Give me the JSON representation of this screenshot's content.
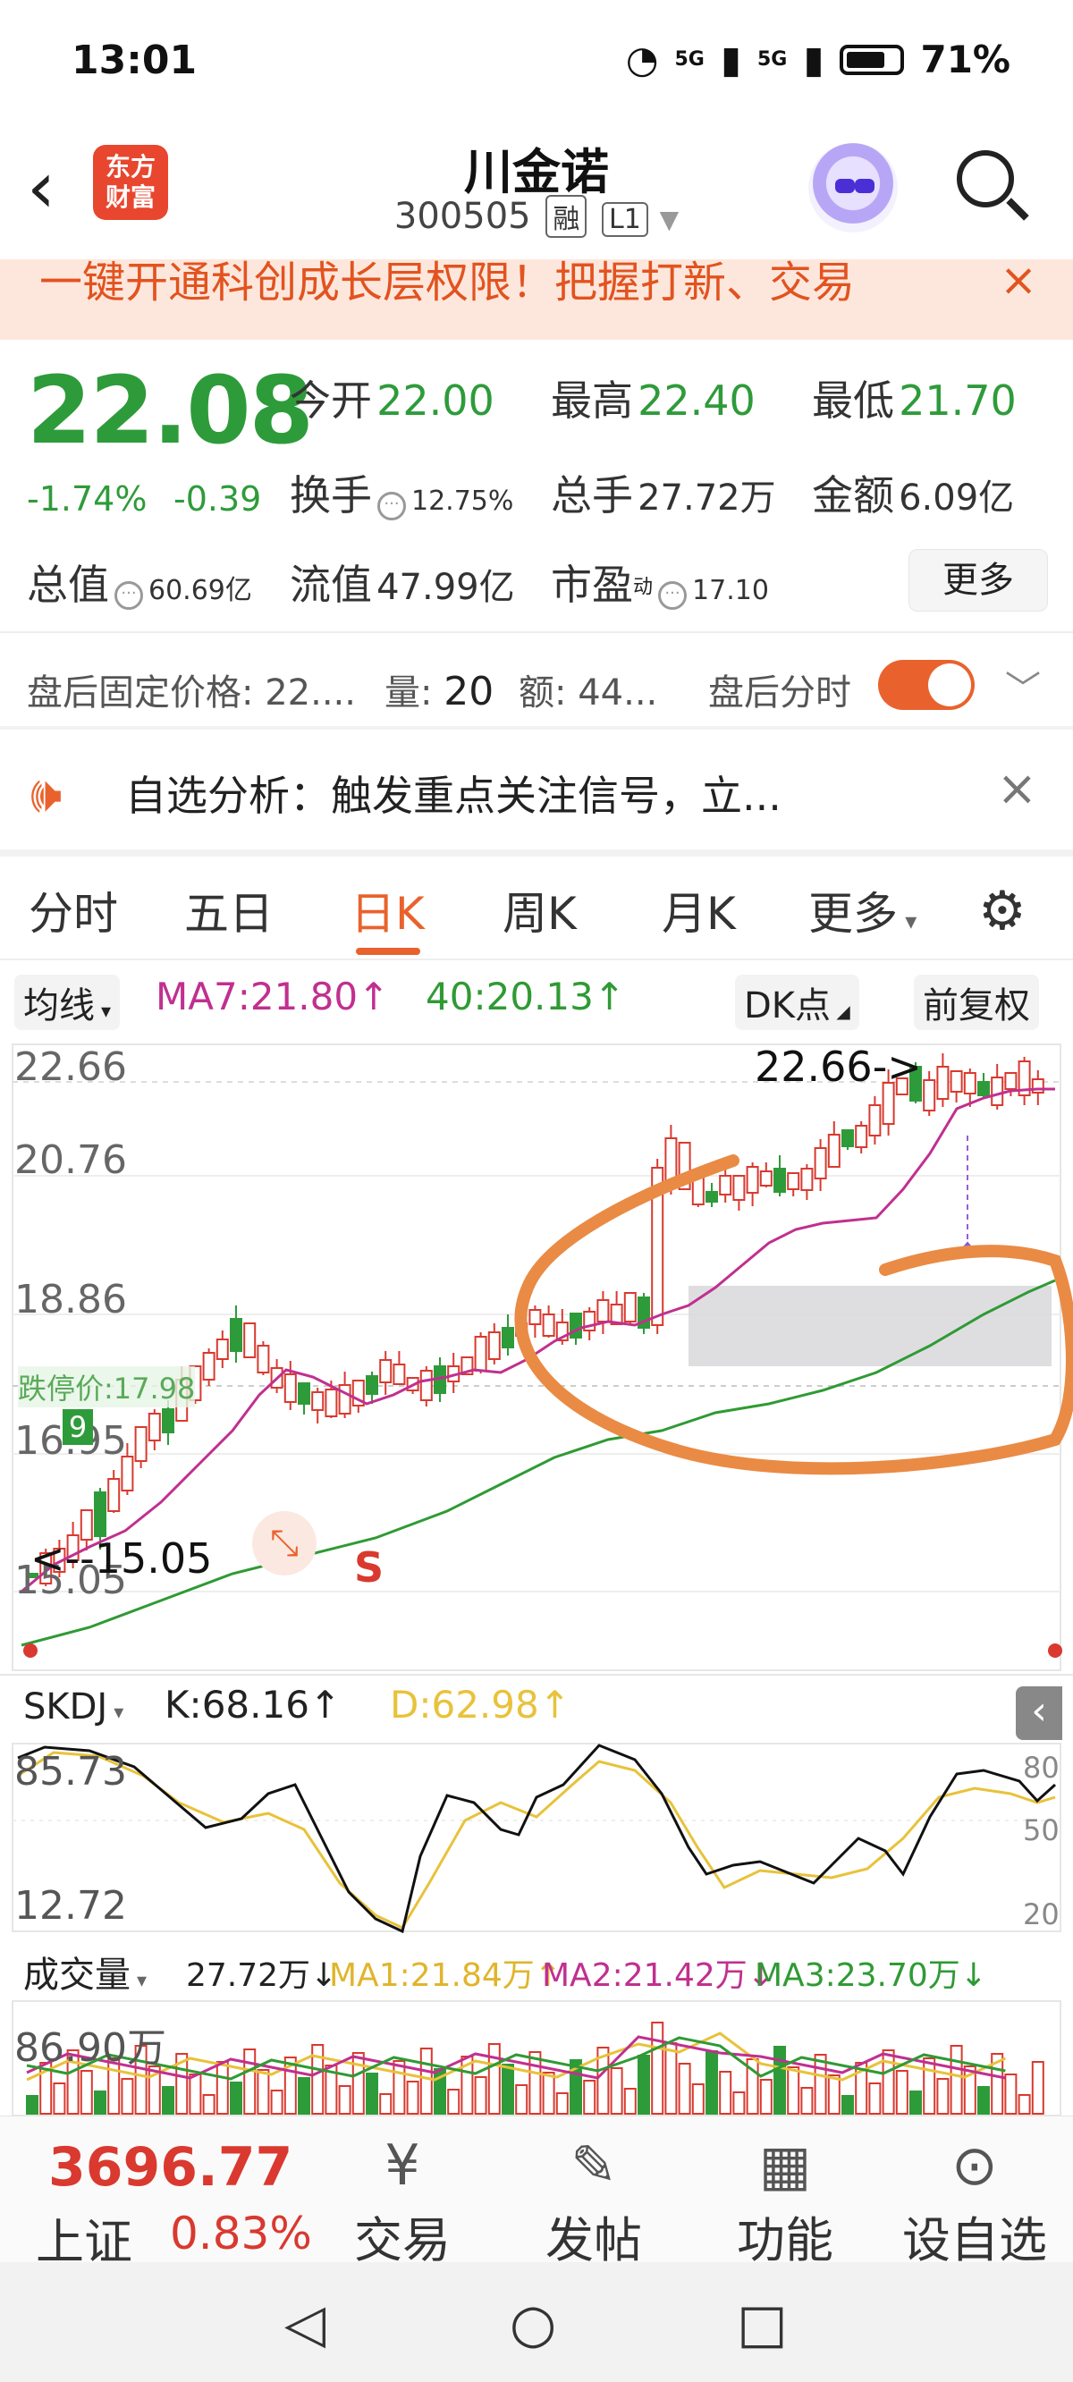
{
  "status": {
    "time": "13:01",
    "net1": "5G",
    "net2": "5G",
    "battery": "71%"
  },
  "header": {
    "title": "川金诺",
    "code": "300505",
    "tag1": "融",
    "tag2": "L1",
    "logo_l1": "东方",
    "logo_l2": "财富"
  },
  "banner": {
    "text": "一键开通科创成长层权限！把握打新、交易",
    "close": "×"
  },
  "quote": {
    "price": "22.08",
    "pct": "-1.74%",
    "change": "-0.39",
    "open_label": "今开",
    "open": "22.00",
    "high_label": "最高",
    "high": "22.40",
    "low_label": "最低",
    "low": "21.70",
    "turnover_label": "换手",
    "turnover": "12.75%",
    "volume_label": "总手",
    "volume": "27.72万",
    "amount_label": "金额",
    "amount": "6.09亿",
    "mcap_label": "总值",
    "mcap": "60.69亿",
    "float_label": "流值",
    "float": "47.99亿",
    "pe_label": "市盈",
    "pe_sup": "动",
    "pe": "17.10",
    "more": "更多"
  },
  "afterhours": {
    "price_label": "盘后固定价格:",
    "price": "22....",
    "vol_label": "量:",
    "vol": "20",
    "amt_label": "额:",
    "amt": "44...",
    "toggle_label": "盘后分时"
  },
  "analysis": {
    "text": "自选分析：触发重点关注信号，立..."
  },
  "tabs": [
    "分时",
    "五日",
    "日K",
    "周K",
    "月K",
    "更多"
  ],
  "chart": {
    "ma_selector": "均线",
    "ma7": "MA7:21.80↑",
    "ma40": "40:20.13↑",
    "dk": "DK点",
    "adjust": "前复权",
    "y_labels": [
      "22.66",
      "20.76",
      "18.86",
      "16.95",
      "15.05"
    ],
    "high_marker": "22.66->",
    "low_marker": "<--15.05",
    "limit_label": "跌停价:17.98",
    "s_marker": "S",
    "badge": "9",
    "skdj_selector": "SKDJ",
    "k": "K:68.16↑",
    "d": "D:62.98↑",
    "skdj_top": "85.73",
    "skdj_bottom": "12.72",
    "skdj_lines": [
      "80",
      "50",
      "20"
    ],
    "vol_selector": "成交量",
    "vol": "27.72万↓",
    "vma1": "MA1:21.84万↑",
    "vma2": "MA2:21.42万↓",
    "vma3": "MA3:23.70万↓",
    "vol_top": "86.90万"
  },
  "chart_data": {
    "type": "candlestick",
    "title": "",
    "ylim": [
      15.05,
      22.66
    ],
    "last_close": 22.08,
    "ma7_last": 21.8,
    "ma40_last": 20.13,
    "skdj": {
      "k": 68.16,
      "d": 62.98,
      "range": [
        12.72,
        85.73
      ]
    },
    "volume": {
      "last": "27.72万",
      "max": "86.90万"
    }
  },
  "bottom": {
    "index_value": "3696.77",
    "index_name": "上证",
    "index_pct": "0.83%",
    "nav": [
      "交易",
      "发帖",
      "功能",
      "设自选"
    ]
  },
  "colors": {
    "up": "#d9392f",
    "down": "#2e9b3a",
    "accent": "#e9622d",
    "ma7": "#c0308f",
    "ma40": "#2f9a34",
    "d_line": "#e8c23a"
  }
}
